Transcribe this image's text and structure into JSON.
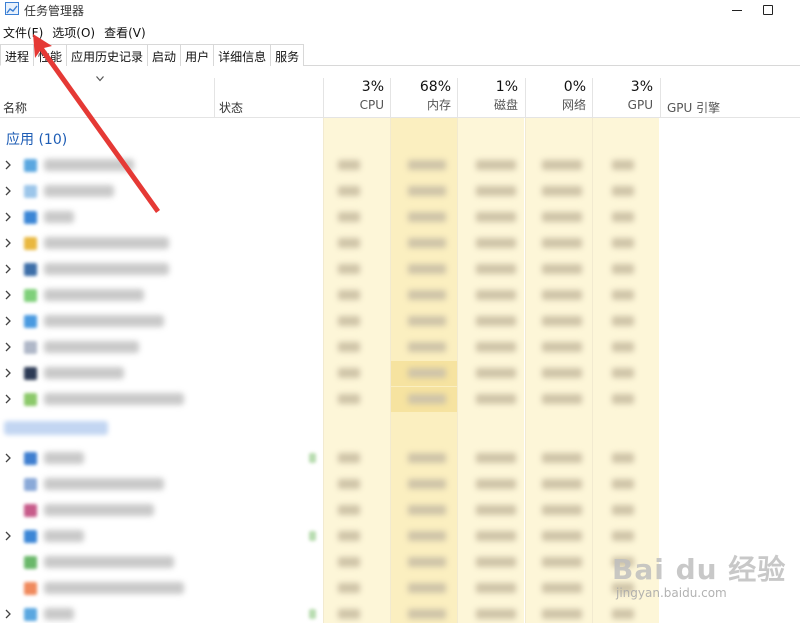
{
  "window": {
    "title": "任务管理器"
  },
  "menu": {
    "items": [
      "文件(F)",
      "选项(O)",
      "查看(V)"
    ]
  },
  "tabs": [
    "进程",
    "性能",
    "应用历史记录",
    "启动",
    "用户",
    "详细信息",
    "服务"
  ],
  "header": {
    "name": "名称",
    "status": "状态",
    "metrics": [
      {
        "pct": "3%",
        "label": "CPU"
      },
      {
        "pct": "68%",
        "label": "内存"
      },
      {
        "pct": "1%",
        "label": "磁盘"
      },
      {
        "pct": "0%",
        "label": "网络"
      },
      {
        "pct": "3%",
        "label": "GPU"
      }
    ],
    "gpu_engine": "GPU 引擎"
  },
  "groups": {
    "apps_title": "应用 (10)"
  },
  "colors": {
    "column_bg": "#fdf6d8",
    "column_hot": "#f8e8a8",
    "accent_blue": "#1e5db5",
    "arrow_red": "#e53935"
  },
  "watermark": {
    "logo": "Bai du 经验",
    "url": "jingyan.baidu.com"
  }
}
